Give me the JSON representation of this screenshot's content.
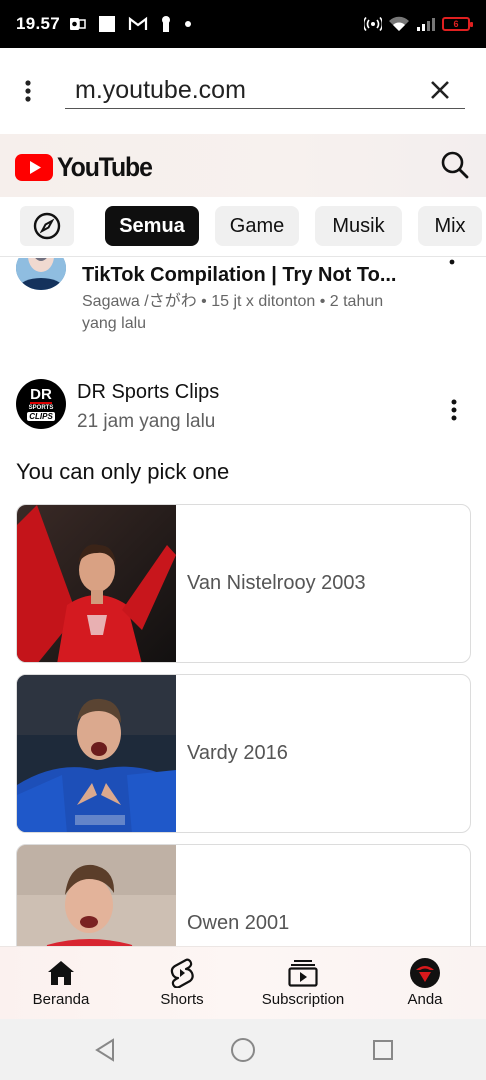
{
  "status_bar": {
    "time": "19.57",
    "battery_level": "6"
  },
  "browser": {
    "url": "m.youtube.com"
  },
  "youtube": {
    "logo_text": "YouTube",
    "chips": [
      "Semua",
      "Game",
      "Musik",
      "Mix"
    ],
    "active_chip": "Semua"
  },
  "previous_video": {
    "title": "TikTok Compilation | Try Not To...",
    "meta_line1": "Sagawa /さがわ • 15 jt x ditonton • 2 tahun",
    "meta_line2": "yang lalu"
  },
  "post": {
    "channel": "DR Sports Clips",
    "time": "21 jam yang lalu",
    "text": "You can only pick one",
    "avatar_text": [
      "DR",
      "SPORTS",
      "CLIPS"
    ],
    "options": [
      {
        "label": "Van Nistelrooy 2003"
      },
      {
        "label": "Vardy 2016"
      },
      {
        "label": "Owen 2001"
      }
    ]
  },
  "bottom_nav": {
    "items": [
      "Beranda",
      "Shorts",
      "Subscription",
      "Anda"
    ]
  },
  "colors": {
    "youtube_red": "#ff0000",
    "chip_active_bg": "#0f0f0f",
    "battery_red": "#e02020"
  }
}
